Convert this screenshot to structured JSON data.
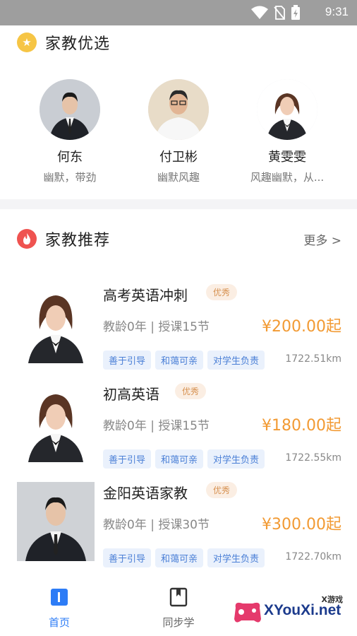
{
  "status_bar": {
    "time": "9:31",
    "icons": [
      "wifi-icon",
      "no-sim-icon",
      "battery-charging-icon"
    ]
  },
  "featured": {
    "title": "家教优选",
    "icon": "star-icon",
    "teachers": [
      {
        "name": "何东",
        "desc": "幽默，带劲"
      },
      {
        "name": "付卫彬",
        "desc": "幽默风趣"
      },
      {
        "name": "黄雯雯",
        "desc": "风趣幽默，从..."
      }
    ]
  },
  "recommend": {
    "title": "家教推荐",
    "icon": "fire-icon",
    "more_label": "更多 >",
    "items": [
      {
        "title": "高考英语冲刺",
        "badge": "优秀",
        "meta": "教龄0年 | 授课15节",
        "price": "¥200.00起",
        "tags": [
          "善于引导",
          "和蔼可亲",
          "对学生负责"
        ],
        "distance": "1722.51km"
      },
      {
        "title": "初高英语",
        "badge": "优秀",
        "meta": "教龄0年 | 授课15节",
        "price": "¥180.00起",
        "tags": [
          "善于引导",
          "和蔼可亲",
          "对学生负责"
        ],
        "distance": "1722.55km"
      },
      {
        "title": "金阳英语家教",
        "badge": "优秀",
        "meta": "教龄0年 | 授课30节",
        "price": "¥300.00起",
        "tags": [
          "善于引导",
          "和蔼可亲",
          "对学生负责"
        ],
        "distance": "1722.70km"
      }
    ]
  },
  "bottom_nav": {
    "items": [
      {
        "label": "首页",
        "icon": "home-book-icon",
        "active": true
      },
      {
        "label": "同步学",
        "icon": "bookmark-book-icon",
        "active": false
      }
    ]
  },
  "watermark": {
    "text": "XYouXi.net",
    "small": "X游戏"
  },
  "colors": {
    "accent": "#2d7cf6",
    "price": "#f29a33",
    "tag_text": "#4a7fd6",
    "badge_text": "#d6904f"
  }
}
